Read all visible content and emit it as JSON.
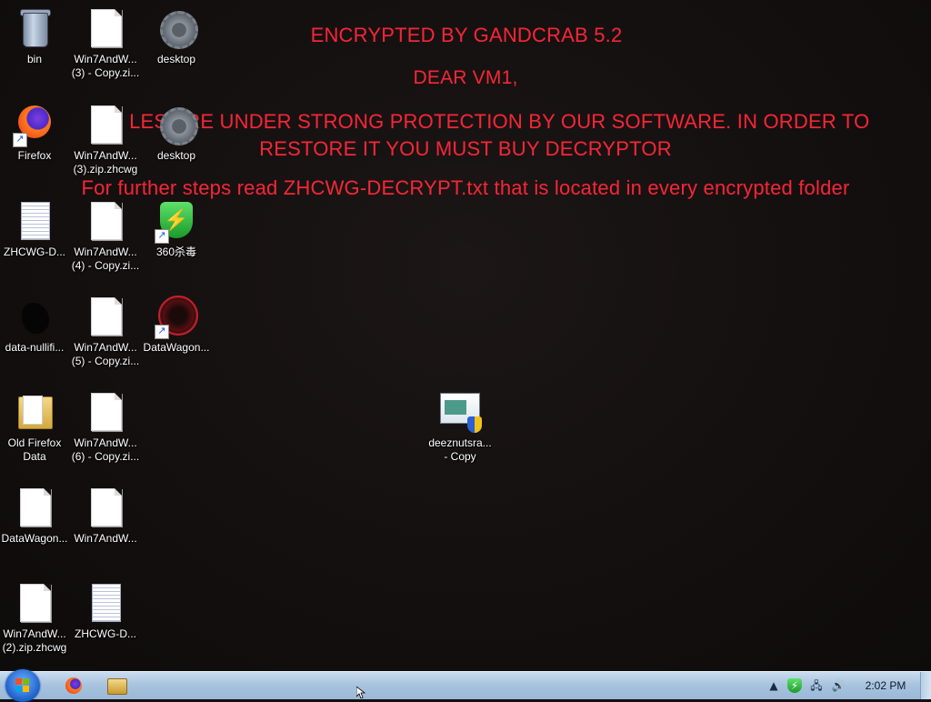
{
  "ransom_note": {
    "title": "ENCRYPTED BY GANDCRAB 5.2",
    "greeting": "DEAR VM1,",
    "line1": "UR  LES ARE UNDER STRONG PROTECTION BY OUR SOFTWARE. IN ORDER TO",
    "line2": "RESTORE IT YOU MUST BUY DECRYPTOR",
    "line3": "For further steps read ZHCWG-DECRYPT.txt that is located in every encrypted folder",
    "color": "#ff2b3c"
  },
  "desktop_icons": {
    "bin": {
      "label": "bin",
      "icon": "recycle-bin-icon"
    },
    "win7_3_copy": {
      "label1": "Win7AndW...",
      "label2": "(3) - Copy.zi...",
      "icon": "blank-file-icon"
    },
    "desktop_1": {
      "label": "desktop",
      "icon": "gear-icon"
    },
    "firefox": {
      "label": "Firefox",
      "icon": "firefox-icon"
    },
    "win7_3_zhcwg": {
      "label1": "Win7AndW...",
      "label2": "(3).zip.zhcwg",
      "icon": "blank-file-icon"
    },
    "desktop_2": {
      "label": "desktop",
      "icon": "gear-icon"
    },
    "zhcwg_d_1": {
      "label": "ZHCWG-D...",
      "icon": "text-file-icon"
    },
    "win7_4_copy": {
      "label1": "Win7AndW...",
      "label2": "(4) - Copy.zi...",
      "icon": "blank-file-icon"
    },
    "av360": {
      "label": "360杀毒",
      "icon": "shield-360-icon"
    },
    "data_nullifier": {
      "label": "data-nullifi...",
      "icon": "dark-blob-icon"
    },
    "win7_5_copy": {
      "label1": "Win7AndW...",
      "label2": "(5) - Copy.zi...",
      "icon": "blank-file-icon"
    },
    "datawagon_shortcut": {
      "label": "DataWagon...",
      "icon": "datawagon-icon"
    },
    "old_firefox_data": {
      "label1": "Old Firefox",
      "label2": "Data",
      "icon": "folder-icon"
    },
    "win7_6_copy": {
      "label1": "Win7AndW...",
      "label2": "(6) - Copy.zi...",
      "icon": "blank-file-icon"
    },
    "deeznuts": {
      "label1": "deeznutsra...",
      "label2": "- Copy",
      "icon": "installer-icon"
    },
    "datawagon_file": {
      "label": "DataWagon...",
      "icon": "blank-file-icon"
    },
    "win7_plain": {
      "label": "Win7AndW...",
      "icon": "blank-file-icon"
    },
    "win7_2_zhcwg": {
      "label1": "Win7AndW...",
      "label2": "(2).zip.zhcwg",
      "icon": "blank-file-icon"
    },
    "zhcwg_d_2": {
      "label": "ZHCWG-D...",
      "icon": "text-file-icon"
    }
  },
  "taskbar": {
    "start": "start-orb-icon",
    "pinned": [
      "firefox-icon",
      "windows-explorer-icon"
    ],
    "tray": {
      "overflow": "▲",
      "icons": [
        "360-shield-icon",
        "network-icon",
        "volume-icon"
      ]
    },
    "clock": "2:02 PM"
  }
}
